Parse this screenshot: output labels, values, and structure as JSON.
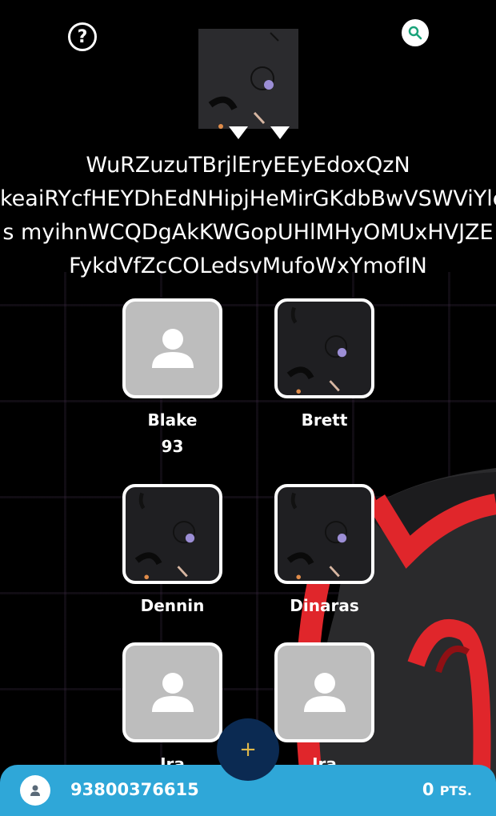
{
  "header": {
    "help_icon": "question-circle-icon",
    "search_icon": "search-icon",
    "description_lines": [
      "WuRZuzuTBrjlEryEEyEdoxQzN",
      "keaiRYcfHEYDhEdNHipjHeMirGKdbBwVSWViYle",
      "s myihnWCQDgAkKWGopUHlMHyOMUxHVJZE",
      "FykdVfZcCOLedsvMufoWxYmofIN"
    ]
  },
  "users": [
    {
      "name": "Blake",
      "score": "93",
      "avatar": "placeholder"
    },
    {
      "name": "Brett",
      "score": "",
      "avatar": "pattern"
    },
    {
      "name": "Dennin",
      "score": "",
      "avatar": "pattern"
    },
    {
      "name": "Dinaras",
      "score": "",
      "avatar": "pattern"
    },
    {
      "name": "Ira",
      "score": "",
      "avatar": "placeholder"
    },
    {
      "name": "Ira",
      "score": "",
      "avatar": "placeholder"
    }
  ],
  "fab": {
    "label": "+"
  },
  "bottom_bar": {
    "phone": "93800376615",
    "points_value": "0",
    "points_unit": "PTS."
  },
  "colors": {
    "bar": "#2fa7d8",
    "fab": "#0b2a52",
    "fab_plus": "#e0b84a",
    "search_icon": "#1aa37a",
    "accent_red": "#e0262b"
  }
}
